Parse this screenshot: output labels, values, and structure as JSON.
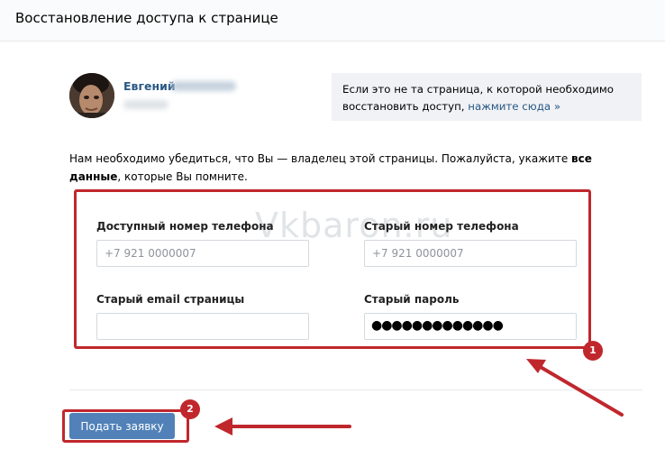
{
  "header": {
    "title": "Восстановление доступа к странице"
  },
  "profile": {
    "first_name": "Евгений"
  },
  "info_box": {
    "text": "Если это не та страница, к которой необходимо восстановить доступ,",
    "link": "нажмите сюда »"
  },
  "intro": {
    "text_before": "Нам необходимо убедиться, что Вы — владелец этой страницы. Пожалуйста, укажите ",
    "bold": "все данные",
    "text_after": ", которые Вы помните."
  },
  "form": {
    "phone_label": "Доступный номер телефона",
    "phone_placeholder": "+7 921 0000007",
    "old_phone_label": "Старый номер телефона",
    "old_phone_placeholder": "+7 921 0000007",
    "email_label": "Старый email страницы",
    "email_value": "",
    "password_label": "Старый пароль",
    "password_masked": "●●●●●●●●●●●●●"
  },
  "submit_button": {
    "label": "Подать заявку"
  },
  "watermark": "Vkbaron.ru",
  "annotations": {
    "badge_1": "1",
    "badge_2": "2",
    "accent_color": "#c0272d"
  },
  "colors": {
    "link": "#2a5885",
    "button": "#5181b8"
  }
}
